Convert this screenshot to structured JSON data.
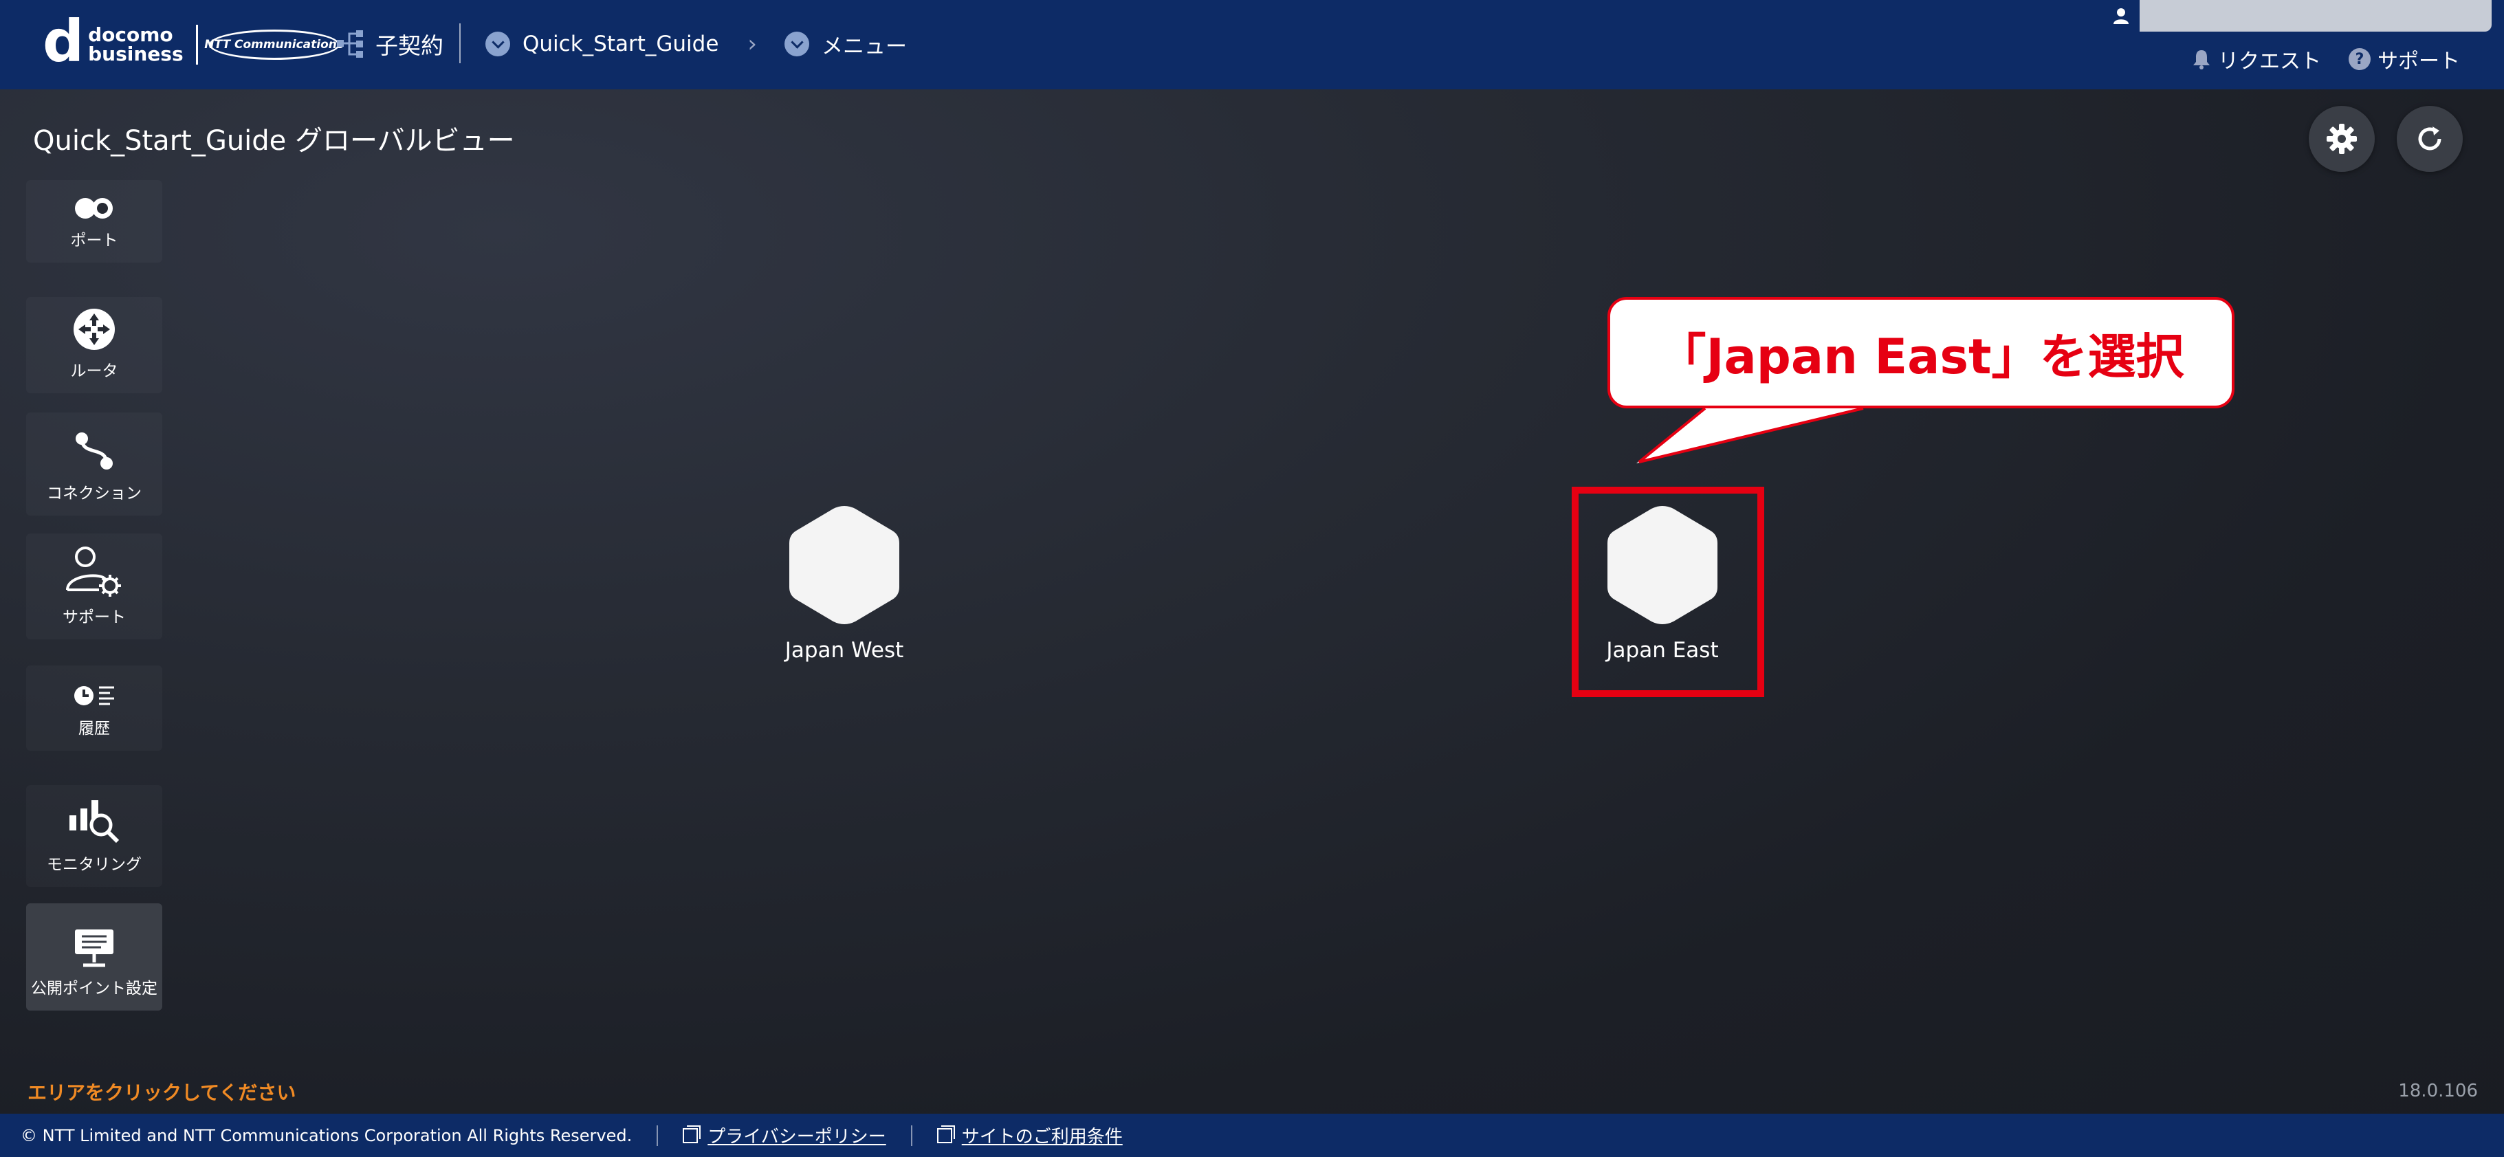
{
  "header": {
    "logo_letter": "d",
    "logo_line1": "docomo",
    "logo_line2": "business",
    "partner_logo": "NTT Communications",
    "sub_contract_label": "子契約",
    "breadcrumb": [
      {
        "label": "Quick_Start_Guide"
      },
      {
        "label": "メニュー"
      }
    ],
    "request_label": "リクエスト",
    "support_label": "サポート",
    "help_glyph": "?"
  },
  "page": {
    "title": "Quick_Start_Guide グローバルビュー"
  },
  "sidebar": {
    "items": [
      {
        "label": "ポート",
        "icon": "port-icon"
      },
      {
        "label": "ルータ",
        "icon": "router-icon"
      },
      {
        "label": "コネクション",
        "icon": "connection-icon"
      },
      {
        "label": "サポート",
        "icon": "support-user-icon"
      },
      {
        "label": "履歴",
        "icon": "history-icon"
      },
      {
        "label": "モニタリング",
        "icon": "monitoring-icon"
      },
      {
        "label": "公開ポイント設定",
        "icon": "public-point-icon"
      }
    ]
  },
  "map": {
    "nodes": [
      {
        "label": "Japan West"
      },
      {
        "label": "Japan East"
      }
    ]
  },
  "annotation": {
    "callout_text": "「Japan East」を選択",
    "color": "#e60012"
  },
  "status": {
    "hint": "エリアをクリックしてください",
    "version": "18.0.106"
  },
  "footer": {
    "copyright": "© NTT Limited and NTT Communications Corporation All Rights Reserved.",
    "privacy_label": "プライバシーポリシー",
    "terms_label": "サイトのご利用条件"
  },
  "colors": {
    "header_bg": "#0d2b66",
    "accent_orange": "#f08a24"
  }
}
